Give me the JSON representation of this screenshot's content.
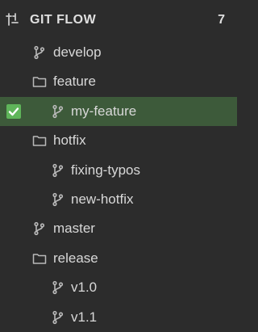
{
  "header": {
    "title": "GIT FLOW",
    "count": "7",
    "icon": "git-flow-icon"
  },
  "tree": [
    {
      "label": "develop",
      "kind": "branch",
      "level": 1
    },
    {
      "label": "feature",
      "kind": "folder",
      "level": 1
    },
    {
      "label": "my-feature",
      "kind": "branch",
      "level": 2,
      "selected": true,
      "checked": true
    },
    {
      "label": "hotfix",
      "kind": "folder",
      "level": 1
    },
    {
      "label": "fixing-typos",
      "kind": "branch",
      "level": 2
    },
    {
      "label": "new-hotfix",
      "kind": "branch",
      "level": 2
    },
    {
      "label": "master",
      "kind": "branch",
      "level": 1
    },
    {
      "label": "release",
      "kind": "folder",
      "level": 1
    },
    {
      "label": "v1.0",
      "kind": "branch",
      "level": 2
    },
    {
      "label": "v1.1",
      "kind": "branch",
      "level": 2
    }
  ],
  "colors": {
    "background": "#2c2c2c",
    "selected_row": "#3d5a3a",
    "checkbox": "#5fb55a",
    "icon": "#b9b9b9"
  }
}
